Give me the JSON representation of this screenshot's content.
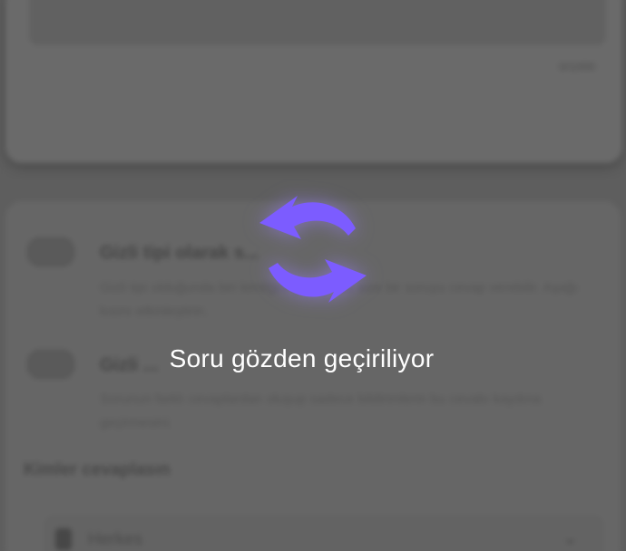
{
  "background": {
    "counter_text": "0/1000",
    "options": [
      {
        "title": "Gizli tipi olarak s...",
        "description": "Gizli tipi olduğunda biri kimliğini gizleyerek size bir soruyu cevap verebilir. Aşağı kısmı etkinleştirin."
      },
      {
        "title": "Gizli ...",
        "description": "Sorunun farklı cevaplardan oluşup sadece bildirimlerin bu cevabı kaydına geçirmesini."
      }
    ],
    "section_heading": "Kimler cevaplasın",
    "select_value": "Herkes"
  },
  "overlay": {
    "message": "Soru gözden geçiriliyor",
    "spinner_color": "#7c5cff",
    "spinner_icon": "refresh-icon"
  }
}
